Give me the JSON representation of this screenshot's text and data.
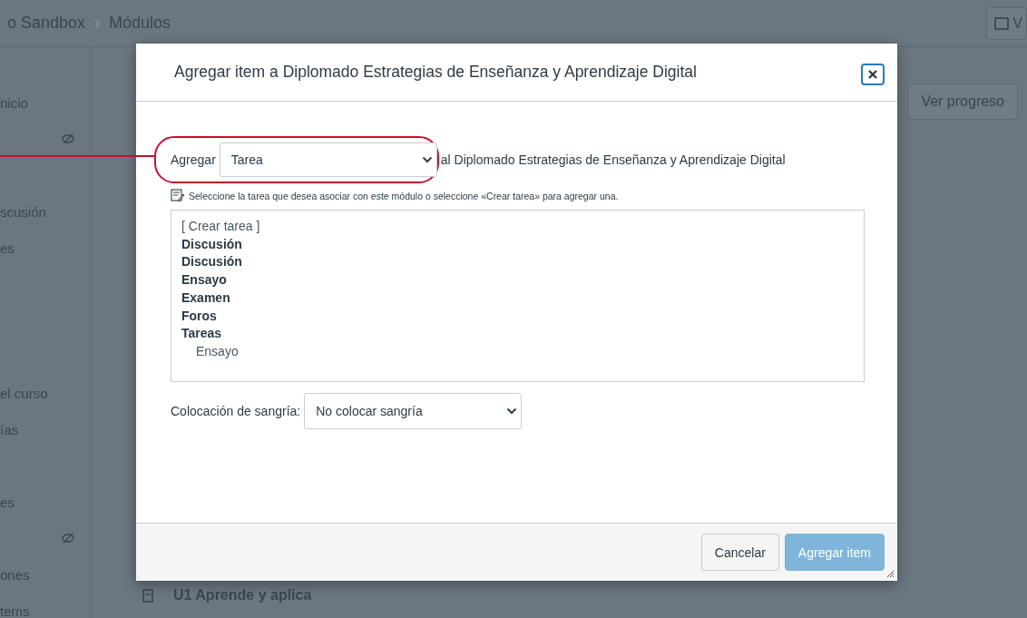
{
  "breadcrumb": [
    "o Sandbox",
    "Módulos"
  ],
  "sidebar": [
    {
      "kind": "text",
      "label": "nicio"
    },
    {
      "kind": "hidden"
    },
    {
      "kind": "gap"
    },
    {
      "kind": "text",
      "label": "scusión"
    },
    {
      "kind": "text",
      "label": "es"
    },
    {
      "kind": "gap"
    },
    {
      "kind": "gap"
    },
    {
      "kind": "gap"
    },
    {
      "kind": "text",
      "label": "el curso"
    },
    {
      "kind": "text",
      "label": "ías"
    },
    {
      "kind": "gap"
    },
    {
      "kind": "text",
      "label": "es"
    },
    {
      "kind": "hidden"
    },
    {
      "kind": "text",
      "label": "ones"
    },
    {
      "kind": "text",
      "label": "tems"
    }
  ],
  "top_button": "V",
  "progress_button": "Ver progreso",
  "module_item": "U1 Aprende y aplica",
  "dialog": {
    "title": "Agregar item a Diplomado Estrategias de Enseñanza y Aprendizaje Digital",
    "add_label": "Agregar",
    "add_type": "Tarea",
    "add_target": "al Diplomado Estrategias de Enseñanza y Aprendizaje Digital",
    "hint": "Seleccione la tarea que desea asociar con este módulo o seleccione «Crear tarea» para agregar una.",
    "options": [
      {
        "kind": "option",
        "label": "[ Crear tarea ]"
      },
      {
        "kind": "group",
        "label": "Discusión"
      },
      {
        "kind": "group",
        "label": "Discusión"
      },
      {
        "kind": "group",
        "label": "Ensayo"
      },
      {
        "kind": "group",
        "label": "Examen"
      },
      {
        "kind": "group",
        "label": "Foros"
      },
      {
        "kind": "group",
        "label": "Tareas",
        "children": [
          {
            "kind": "option",
            "label": "Ensayo"
          }
        ]
      }
    ],
    "indent_label": "Colocación de sangría:",
    "indent_value": "No colocar sangría",
    "buttons": [
      {
        "label": "Cancelar",
        "kind": "secondary",
        "disabled": false
      },
      {
        "label": "Agregar item",
        "kind": "primary",
        "disabled": true
      }
    ]
  },
  "callout": {
    "color": "#c8102e"
  }
}
